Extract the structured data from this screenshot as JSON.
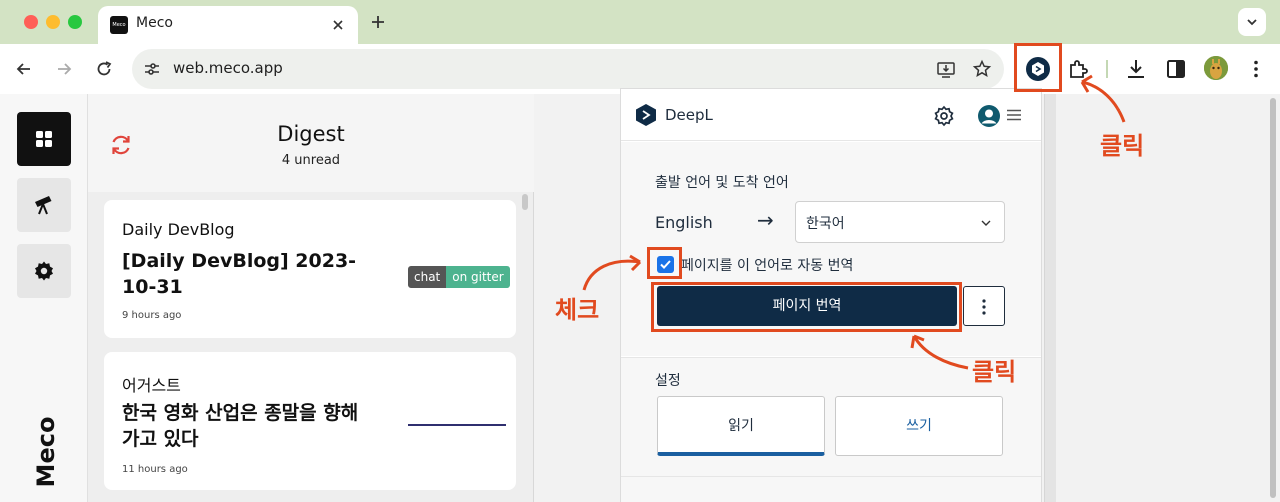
{
  "browser": {
    "tab_title": "Meco",
    "favicon_text": "Meco",
    "url": "web.meco.app"
  },
  "app": {
    "logo": "Meco",
    "digest": {
      "title": "Digest",
      "subtitle": "4 unread"
    },
    "cards": [
      {
        "source": "Daily DevBlog",
        "title_line1": "[Daily DevBlog] 2023-",
        "title_line2": "10-31",
        "time": "9 hours ago",
        "badge_left": "chat",
        "badge_right": "on gitter"
      },
      {
        "source": "어거스트",
        "title_line1": "한국 영화 산업은 종말을 향해",
        "title_line2": "가고 있다",
        "time": "11 hours ago"
      }
    ]
  },
  "deepl": {
    "name": "DeepL",
    "lang_section_label": "출발 언어 및 도착 언어",
    "source_lang": "English",
    "arrow": "→",
    "target_lang": "한국어",
    "auto_translate_label": "페이지를 이 언어로 자동 번역",
    "auto_translate_checked": true,
    "translate_button": "페이지 번역",
    "settings_label": "설정",
    "mode_read": "읽기",
    "mode_write": "쓰기"
  },
  "annotations": {
    "click_top": "클릭",
    "check": "체크",
    "click_bottom": "클릭",
    "color": "#e14a1f"
  },
  "colors": {
    "tabstrip": "#d3e3c4",
    "deepl_navy": "#0f2b46",
    "badge_green": "#4db38f"
  }
}
